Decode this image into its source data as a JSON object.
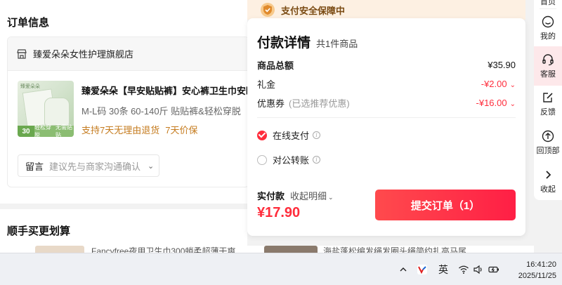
{
  "order": {
    "section_title": "订单信息",
    "shop_name": "臻爱朵朵女性护理旗舰店",
    "product": {
      "title": "臻爱朵朵【早安贴贴裤】安心裤卫生巾安睡",
      "spec": "M-L码 30条 60-140斤 贴贴裤&轻松穿脱",
      "tags": [
        "支持7天无理由退货",
        "7天价保"
      ],
      "image_badge": "30",
      "image_strip_a": "轻松穿脱",
      "image_strip_b": "无需贴贴",
      "image_brand": "臻爱朵朵"
    },
    "remark": {
      "label": "留言",
      "placeholder": "建议先与商家沟通确认"
    }
  },
  "recommend": {
    "title": "顺手买更划算",
    "peek_1": "Fancyfree夜用卫生巾300蛸柔超薄干爽",
    "peek_2": "海盐蓬松编发绳发圈头绳简约扎高马尾"
  },
  "payment": {
    "banner": "支付安全保障中",
    "title": "付款详情",
    "count": "共1件商品",
    "rows": {
      "subtotal_label": "商品总额",
      "subtotal_value": "¥35.90",
      "gift_label": "礼金",
      "gift_value": "-¥2.00",
      "coupon_label": "优惠券",
      "coupon_hint": "(已选推荐优惠)",
      "coupon_value": "-¥16.00"
    },
    "methods": [
      {
        "label": "在线支付",
        "selected": true
      },
      {
        "label": "对公转账",
        "selected": false
      }
    ],
    "paid_label": "实付款",
    "detail_toggle": "收起明细",
    "total": "¥17.90",
    "submit": "提交订单（1）",
    "accent_color": "#ff2d3c"
  },
  "sidebar": {
    "top_partial": "首页",
    "items": [
      {
        "label": "我的",
        "icon": "smile-icon"
      },
      {
        "label": "客服",
        "icon": "headset-icon"
      },
      {
        "label": "反馈",
        "icon": "feedback-icon"
      },
      {
        "label": "回顶部",
        "icon": "arrow-up-icon"
      },
      {
        "label": "收起",
        "icon": "chevron-right-icon"
      }
    ]
  },
  "taskbar": {
    "ime": "英",
    "time": "16:41:20",
    "date": "2025/11/25"
  }
}
